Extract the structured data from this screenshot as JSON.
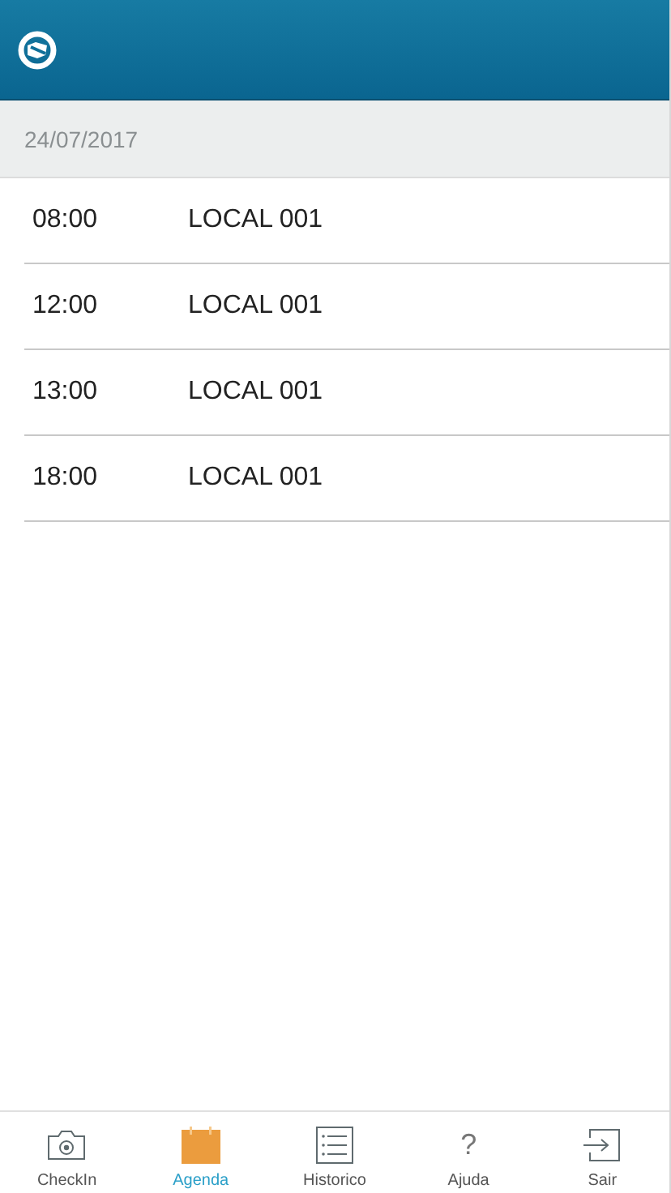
{
  "header": {
    "date": "24/07/2017"
  },
  "schedule": [
    {
      "time": "08:00",
      "place": "LOCAL 001"
    },
    {
      "time": "12:00",
      "place": "LOCAL 001"
    },
    {
      "time": "13:00",
      "place": "LOCAL 001"
    },
    {
      "time": "18:00",
      "place": "LOCAL 001"
    }
  ],
  "nav": [
    {
      "kind": "camera",
      "label": "CheckIn",
      "selected": false
    },
    {
      "kind": "calendar",
      "label": "Agenda",
      "selected": true
    },
    {
      "kind": "list",
      "label": "Historico",
      "selected": false
    },
    {
      "kind": "help",
      "glyph": "?",
      "label": "Ajuda",
      "selected": false
    },
    {
      "kind": "exit",
      "label": "Sair",
      "selected": false
    }
  ]
}
